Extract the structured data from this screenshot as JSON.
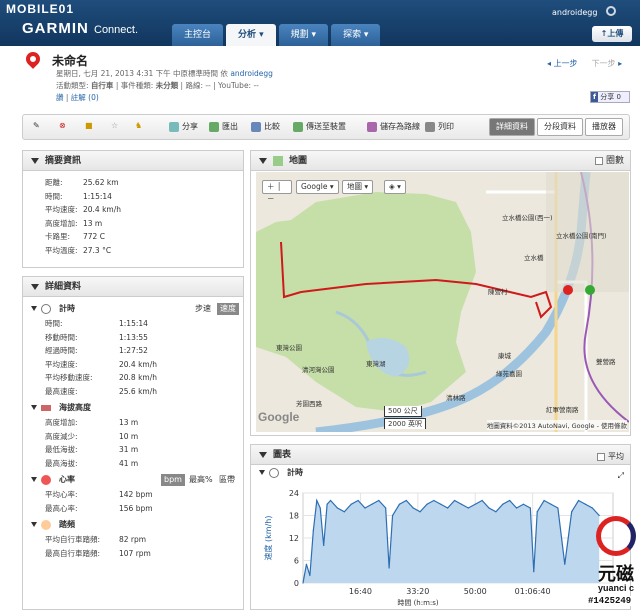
{
  "header": {
    "mobile_logo": "MOBILE01",
    "brand": "GARMIN",
    "brand_sub": "Connect.",
    "username": "androidegg",
    "tabs": [
      {
        "label": "主控台"
      },
      {
        "label": "分析 ▾"
      },
      {
        "label": "規劃 ▾"
      },
      {
        "label": "探索 ▾"
      }
    ],
    "upload_label": "上傳"
  },
  "activity": {
    "title": "未命名",
    "meta_line1": "星期日, 七月 21, 2013 4:31 下午 中原標準時間 依",
    "author": "androidegg",
    "meta_line2_prefix": "活動類型:",
    "type": "自行車",
    "meta_line2_mid": "| 事件種類:",
    "event": "未分類",
    "meta_line2_suffix": "| 路線: -- | YouTube: --",
    "like": "讚",
    "comments": "註解 (0)",
    "prev": "上一步",
    "next": "下一步",
    "fb_label": "f",
    "fb_count": "0"
  },
  "toolbar": {
    "buttons": [
      "分享",
      "匯出",
      "比較",
      "傳送至裝置",
      "儲存為路線",
      "列印"
    ],
    "views": [
      "詳細資料",
      "分段資料",
      "播放器"
    ]
  },
  "summary": {
    "title": "摘要資訊",
    "rows": [
      {
        "k": "距離:",
        "v": "25.62 km"
      },
      {
        "k": "時間:",
        "v": "1:15:14"
      },
      {
        "k": "平均速度:",
        "v": "20.4 km/h"
      },
      {
        "k": "高度增加:",
        "v": "13 m"
      },
      {
        "k": "卡路里:",
        "v": "772 C"
      },
      {
        "k": "平均溫度:",
        "v": "27.3 °C"
      }
    ]
  },
  "details": {
    "title": "詳細資料",
    "timing": {
      "title": "計時",
      "pace": "步速",
      "speed": "速度",
      "rows": [
        {
          "k": "時間:",
          "v": "1:15:14"
        },
        {
          "k": "移動時間:",
          "v": "1:13:55"
        },
        {
          "k": "經過時間:",
          "v": "1:27:52"
        },
        {
          "k": "平均速度:",
          "v": "20.4 km/h"
        },
        {
          "k": "平均移動速度:",
          "v": "20.8 km/h"
        },
        {
          "k": "最高速度:",
          "v": "25.6 km/h"
        }
      ]
    },
    "elevation": {
      "title": "海拔高度",
      "rows": [
        {
          "k": "高度增加:",
          "v": "13 m"
        },
        {
          "k": "高度減少:",
          "v": "10 m"
        },
        {
          "k": "最低海拔:",
          "v": "31 m"
        },
        {
          "k": "最高海拔:",
          "v": "41 m"
        }
      ]
    },
    "hr": {
      "title": "心率",
      "opts": [
        "bpm",
        "最高%",
        "區帶"
      ],
      "rows": [
        {
          "k": "平均心率:",
          "v": "142 bpm"
        },
        {
          "k": "最高心率:",
          "v": "156 bpm"
        }
      ]
    },
    "cadence": {
      "title": "踏頻",
      "rows": [
        {
          "k": "平均自行車踏頻:",
          "v": "82 rpm"
        },
        {
          "k": "最高自行車踏頻:",
          "v": "107 rpm"
        }
      ]
    }
  },
  "map": {
    "title": "地圖",
    "circle_label": "圈數",
    "ctl_google": "Google ▾",
    "ctl_map": "地圖 ▾",
    "scale_m": "500 公尺",
    "scale_ft": "2000 英呎",
    "attribution": "地圖資料©2013 AutoNavi, Google - 使用條款",
    "labels": [
      "立水橋公園(西一)",
      "立水橋",
      "立水橋公園(南門)",
      "陳營村",
      "東灣公園",
      "清河灣公園",
      "東灣湖",
      "康城",
      "綠苑嘉園",
      "清林路",
      "紅軍營南路",
      "雙營路",
      "芳園西路"
    ]
  },
  "graph": {
    "title": "圖表",
    "avg_label": "平均",
    "sub_title": "計時",
    "ylabel": "速度 (km/h)",
    "xlabel": "時間 (h:m:s)"
  },
  "chart_data": {
    "type": "area",
    "xlabel": "時間 (h:m:s)",
    "ylabel": "速度 (km/h)",
    "ylim": [
      0,
      24
    ],
    "yticks": [
      0,
      6,
      12,
      18,
      24
    ],
    "xticks": [
      "16:40",
      "33:20",
      "50:00",
      "01:06:40"
    ],
    "x_minutes": [
      0,
      1,
      2,
      3,
      4,
      5,
      6,
      7,
      8,
      10,
      12,
      14,
      16,
      18,
      20,
      22,
      24,
      25,
      26,
      28,
      30,
      32,
      34,
      36,
      38,
      40,
      42,
      44,
      46,
      48,
      50,
      52,
      54,
      56,
      58,
      60,
      62,
      64,
      66,
      67,
      68,
      70,
      72,
      74,
      76,
      78,
      80,
      82,
      84,
      86
    ],
    "values": [
      0,
      5,
      2,
      14,
      22,
      20,
      10,
      21,
      22,
      20,
      19,
      21,
      22,
      20,
      21,
      22,
      20,
      4,
      18,
      21,
      22,
      20,
      19,
      21,
      22,
      21,
      20,
      22,
      21,
      20,
      21,
      22,
      20,
      19,
      21,
      22,
      20,
      21,
      20,
      3,
      19,
      22,
      21,
      20,
      5,
      19,
      22,
      21,
      20,
      18
    ]
  },
  "watermark": {
    "brand": "元磁",
    "sub": "yuanci c",
    "id": "#1425249"
  },
  "colors": {
    "header": "#1f4d7c",
    "route": "#d0191b",
    "chart_fill": "#bdd7ee",
    "chart_line": "#2d6eb3"
  }
}
